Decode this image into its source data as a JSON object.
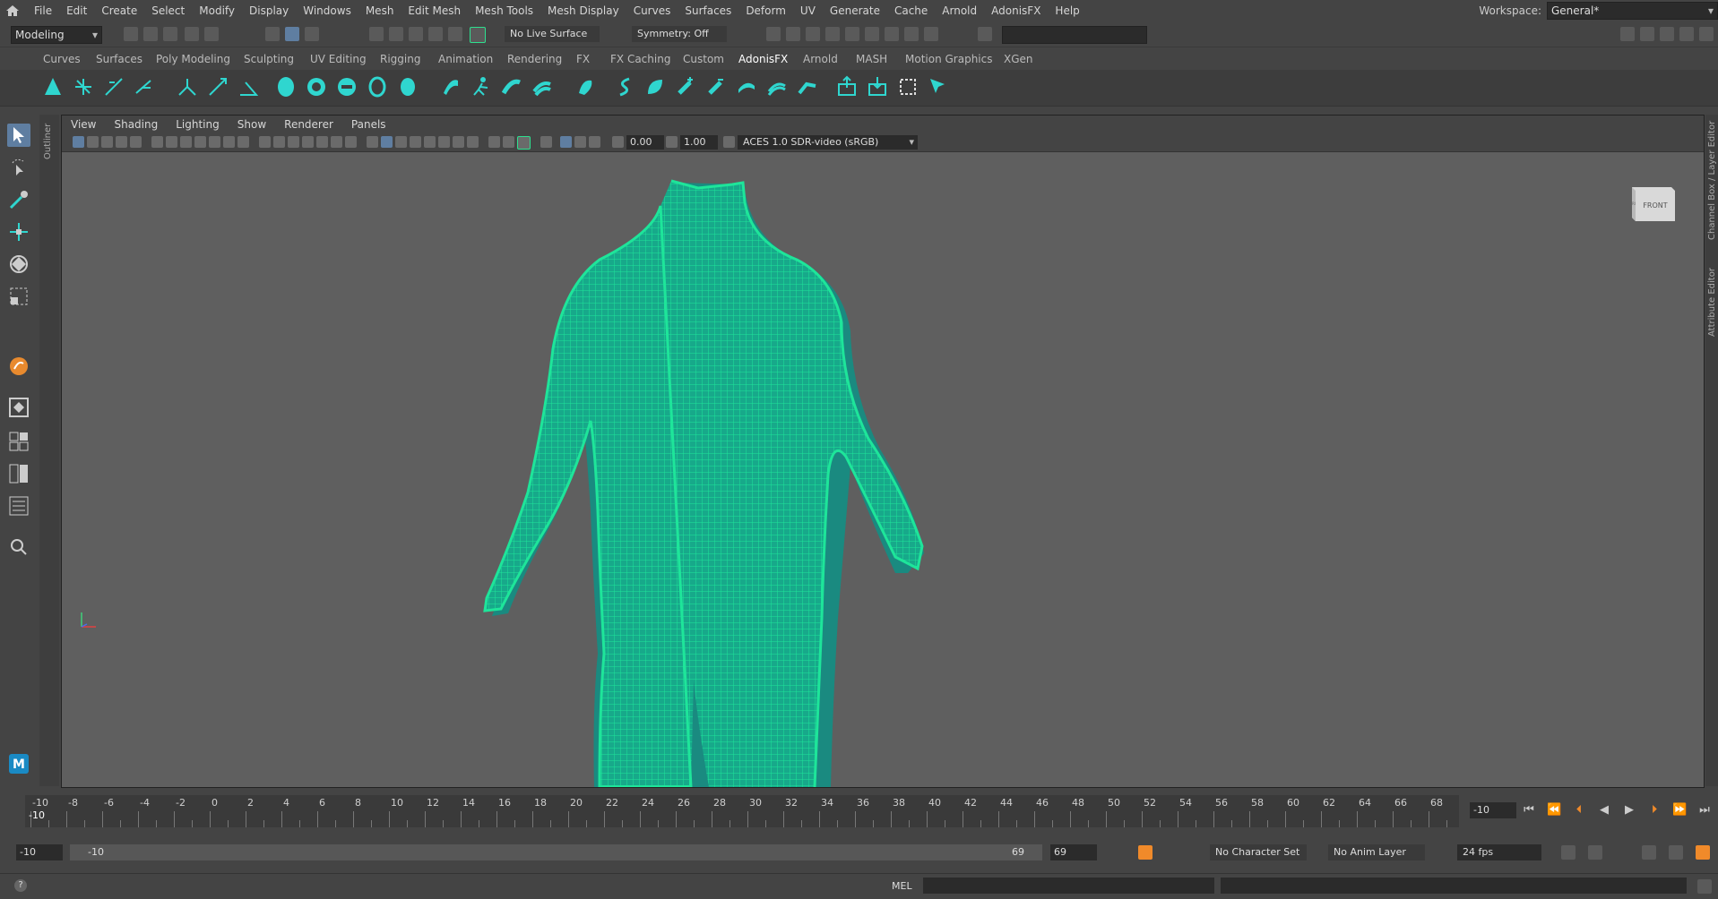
{
  "menubar": {
    "items": [
      "File",
      "Edit",
      "Create",
      "Select",
      "Modify",
      "Display",
      "Windows",
      "Mesh",
      "Edit Mesh",
      "Mesh Tools",
      "Mesh Display",
      "Curves",
      "Surfaces",
      "Deform",
      "UV",
      "Generate",
      "Cache",
      "Arnold",
      "AdonisFX",
      "Help"
    ],
    "workspace_label": "Workspace:",
    "workspace_value": "General*"
  },
  "statusline": {
    "mode": "Modeling",
    "live_surface": "No Live Surface",
    "symmetry": "Symmetry: Off"
  },
  "shelf": {
    "tabs": [
      "Curves",
      "Surfaces",
      "Poly Modeling",
      "Sculpting",
      "UV Editing",
      "Rigging",
      "Animation",
      "Rendering",
      "FX",
      "FX Caching",
      "Custom",
      "AdonisFX",
      "Arnold",
      "MASH",
      "Motion Graphics",
      "XGen"
    ],
    "active_tab": "AdonisFX"
  },
  "side_labels": {
    "outliner": "Outliner",
    "channel_box": "Channel Box / Layer Editor",
    "attribute_editor": "Attribute Editor"
  },
  "viewport": {
    "menus": [
      "View",
      "Shading",
      "Lighting",
      "Show",
      "Renderer",
      "Panels"
    ],
    "exposure": "0.00",
    "gamma": "1.00",
    "color_space": "ACES 1.0 SDR-video (sRGB)",
    "viewcube_label": "FRONT",
    "viewcube_side": "RI",
    "mesh_color": "#1ee59a",
    "background": "#5f5f5f"
  },
  "timeslider": {
    "tick_labels": [
      "-10",
      "-8",
      "-6",
      "-4",
      "-2",
      "0",
      "2",
      "4",
      "6",
      "8",
      "10",
      "12",
      "14",
      "16",
      "18",
      "20",
      "22",
      "24",
      "26",
      "28",
      "30",
      "32",
      "34",
      "36",
      "38",
      "40",
      "42",
      "44",
      "46",
      "48",
      "50",
      "52",
      "54",
      "56",
      "58",
      "60",
      "62",
      "64",
      "66",
      "68"
    ],
    "current_frame_marker": "-10",
    "current_frame": "-10"
  },
  "rangebar": {
    "start": "-10",
    "range_start": "-10",
    "range_end": "69",
    "end": "69",
    "character_set": "No Character Set",
    "anim_layer": "No Anim Layer",
    "fps": "24 fps"
  },
  "cmdline": {
    "lang": "MEL",
    "help": "?"
  }
}
